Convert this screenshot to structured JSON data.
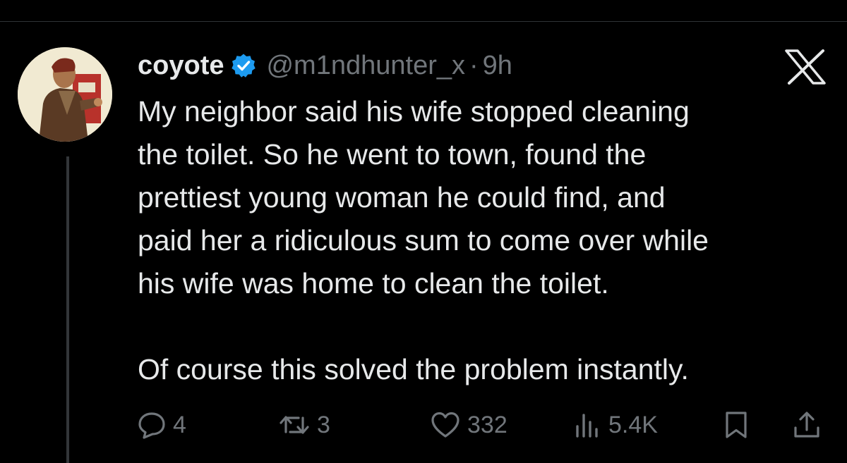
{
  "tweet": {
    "author": {
      "display_name": "coyote",
      "handle": "@m1ndhunter_x",
      "verified": true,
      "verified_color": "#1d9bf0"
    },
    "separator": "·",
    "time": "9h",
    "lines": [
      "My neighbor said his wife stopped cleaning",
      "the toilet. So he went to town, found the",
      "prettiest young woman he could find, and",
      "paid her a ridiculous sum to come over while",
      "his wife was home to clean the toilet.",
      "",
      "Of course this solved the problem instantly."
    ],
    "stats": {
      "replies": "4",
      "reposts": "3",
      "likes": "332",
      "views": "5.4K"
    }
  },
  "icons": {
    "close": "x-logo-icon",
    "reply": "speech-bubble-icon",
    "repost": "repost-arrows-icon",
    "like": "heart-icon",
    "views": "bar-chart-icon",
    "bookmark": "bookmark-icon",
    "share": "share-upload-icon"
  },
  "colors": {
    "background": "#000000",
    "text": "#e7e9ea",
    "muted": "#71767b",
    "accent": "#1d9bf0"
  }
}
